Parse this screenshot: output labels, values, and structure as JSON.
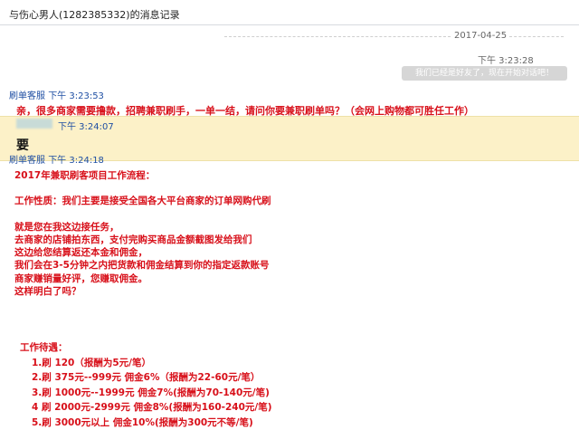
{
  "header": {
    "title": "与伤心男人(1282385332)的消息记录"
  },
  "date_divider": {
    "date": "2017-04-25"
  },
  "system": {
    "time": "下午 3:23:28",
    "notice": "我们已经是好友了，现在开始对话吧！"
  },
  "messages": [
    {
      "sender": "刷单客服",
      "time": "下午 3:23:53",
      "text": "亲，很多商家需要撸款，招聘兼职刷手，一单一结，请问你要兼职刷单吗？（会网上购物都可胜任工作）"
    },
    {
      "time": "下午 3:24:07",
      "text": "要"
    },
    {
      "sender": "刷单客服",
      "time": "下午 3:24:18",
      "lines": [
        "2017年兼职刷客项目工作流程：",
        "",
        "工作性质：我们主要是接受全国各大平台商家的订单网购代刷",
        "",
        "就是您在我这边接任务，",
        "去商家的店铺拍东西，支付完购买商品金额截图发给我们",
        "这边给您结算返还本金和佣金，",
        "我们会在3-5分钟之内把货款和佣金结算到你的指定返款账号",
        "商家赚销量好评，您赚取佣金。",
        "这样明白了吗？"
      ],
      "perks_title": "工作待遇：",
      "perks": [
        "1.刷 120（报酬为5元/笔）",
        "2.刷 375元--999元 佣金6%（报酬为22-60元/笔）",
        "3.刷 1000元--1999元 佣金7%(报酬为70-140元/笔)",
        "4 刷 2000元-2999元 佣金8%(报酬为160-240元/笔)",
        "5.刷 3000元以上 佣金10%(报酬为300元不等/笔)"
      ]
    }
  ]
}
